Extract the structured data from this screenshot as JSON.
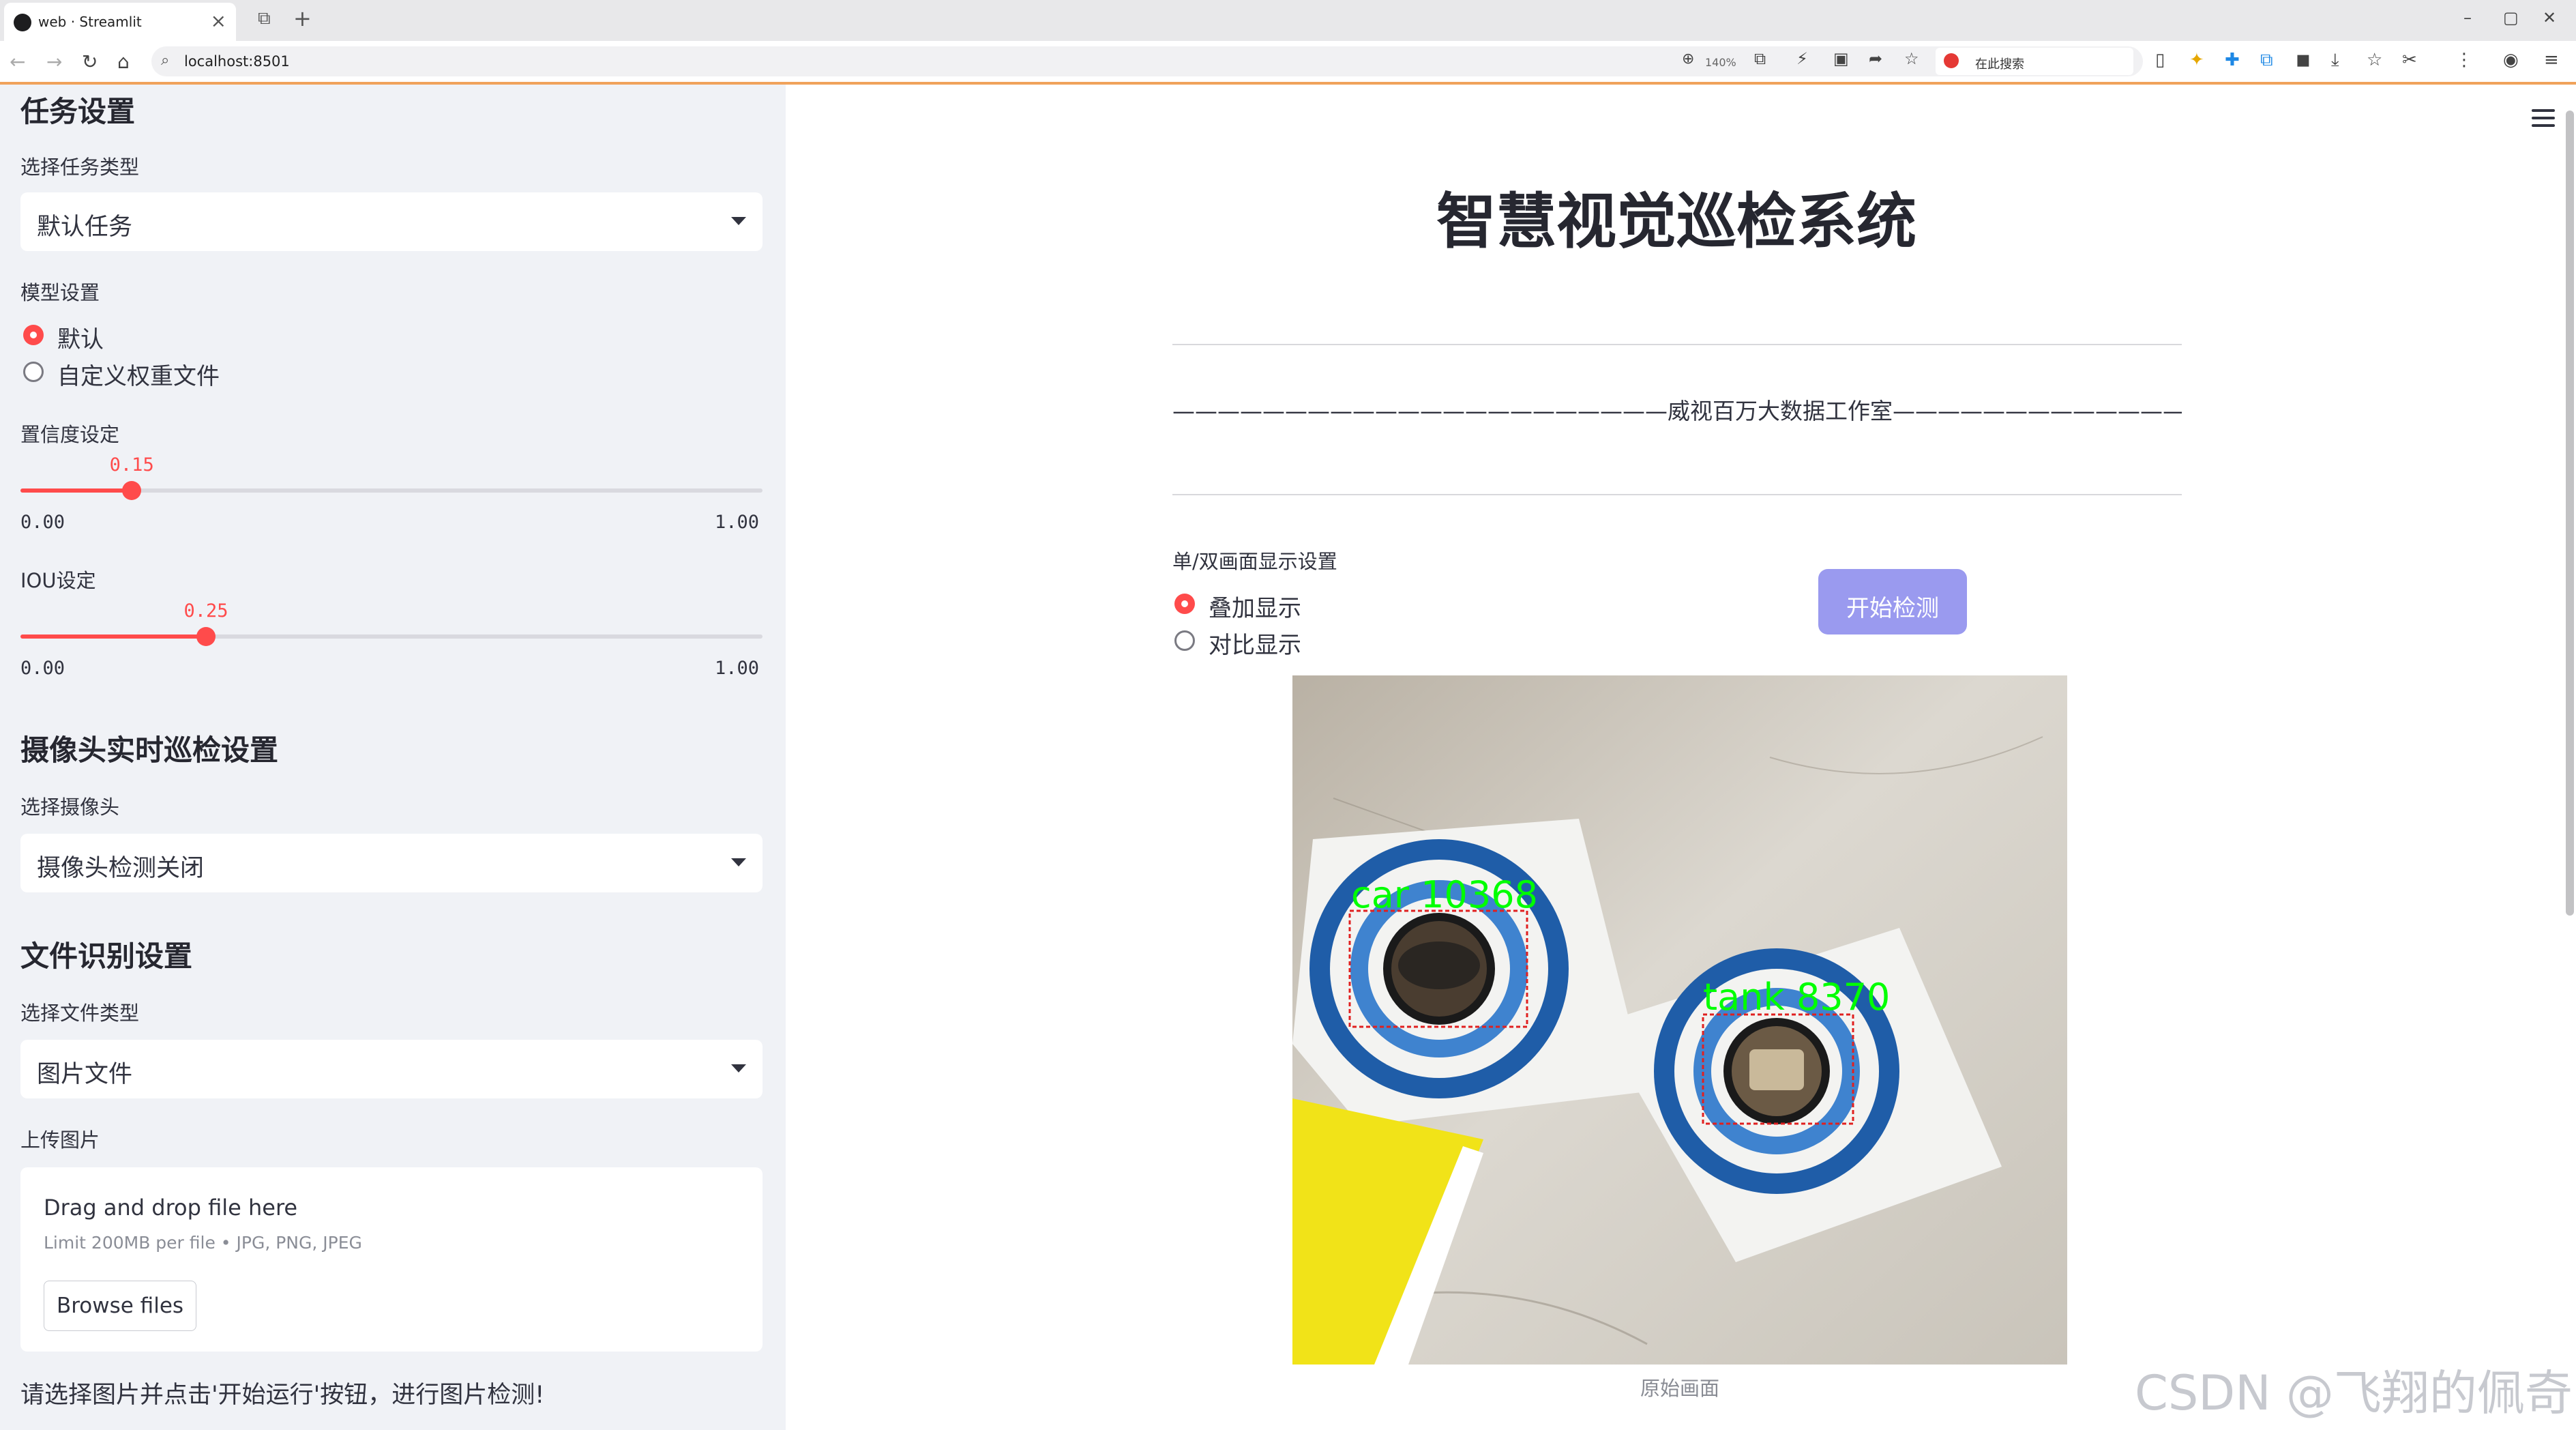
{
  "browser": {
    "tab_title": "web · Streamlit",
    "tab_close": "×",
    "new_tab": "+",
    "url": "localhost:8501",
    "zoom": "140%",
    "search_placeholder": "在此搜索",
    "window_controls": [
      "–",
      "▢",
      "✕"
    ]
  },
  "sidebar": {
    "task_section_title": "任务设置",
    "task_type_label": "选择任务类型",
    "task_type_value": "默认任务",
    "model_label": "模型设置",
    "model_options": [
      "默认",
      "自定义权重文件"
    ],
    "model_selected": 0,
    "confidence": {
      "label": "置信度设定",
      "value_text": "0.15",
      "value": 0.15,
      "min": "0.00",
      "max": "1.00"
    },
    "iou": {
      "label": "IOU设定",
      "value_text": "0.25",
      "value": 0.25,
      "min": "0.00",
      "max": "1.00"
    },
    "camera_section_title": "摄像头实时巡检设置",
    "camera_label": "选择摄像头",
    "camera_value": "摄像头检测关闭",
    "file_section_title": "文件识别设置",
    "file_type_label": "选择文件类型",
    "file_type_value": "图片文件",
    "upload_label": "上传图片",
    "uploader": {
      "title": "Drag and drop file here",
      "subtitle": "Limit 200MB per file • JPG, PNG, JPEG",
      "button": "Browse files"
    },
    "hint": "请选择图片并点击'开始运行'按钮，进行图片检测!"
  },
  "main": {
    "title": "智慧视觉巡检系统",
    "studio_line": "——————————————————————威视百万大数据工作室———————————————————————",
    "display_label": "单/双画面显示设置",
    "display_options": [
      "叠加显示",
      "对比显示"
    ],
    "display_selected": 0,
    "start_button": "开始检测",
    "image_caption": "原始画面",
    "detections": [
      {
        "label": "car",
        "score_text": "10368",
        "color": "#00ff00"
      },
      {
        "label": "tank",
        "score_text": "8370",
        "color": "#00ff00"
      }
    ]
  },
  "watermark": "CSDN @飞翔的佩奇",
  "colors": {
    "accent": "#ff4b4b",
    "sidebar_bg": "#f0f2f6",
    "button_bg": "#9a9aef",
    "browser_accent_line": "#f0a25b"
  }
}
